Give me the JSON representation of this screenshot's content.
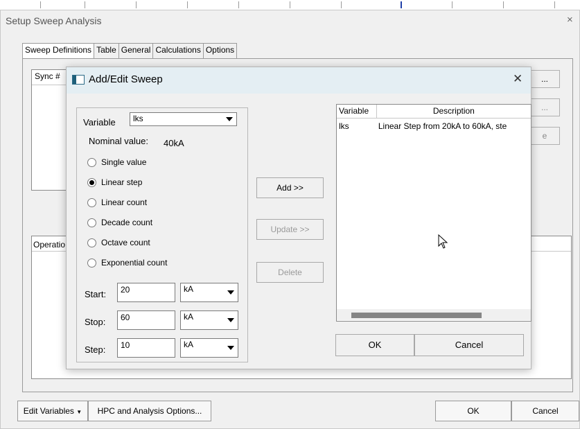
{
  "outer": {
    "title": "Setup Sweep Analysis",
    "close_glyph": "×",
    "tabs": [
      {
        "label": "Sweep Definitions",
        "active": true
      },
      {
        "label": "Table",
        "active": false
      },
      {
        "label": "General",
        "active": false
      },
      {
        "label": "Calculations",
        "active": false
      },
      {
        "label": "Options",
        "active": false
      }
    ],
    "sync_header": "Sync #",
    "operation_header": "Operatio",
    "side_button_1": "...",
    "side_button_2": "...",
    "side_button_3": "e",
    "edit_variables_label": "Edit Variables",
    "hpc_label": "HPC and Analysis Options...",
    "ok_label": "OK",
    "cancel_label": "Cancel"
  },
  "dialog": {
    "title": "Add/Edit Sweep",
    "close_glyph": "✕",
    "variable_label": "Variable",
    "variable_value": "lks",
    "nominal_label": "Nominal value:",
    "nominal_value": "40kA",
    "sweep_types": [
      {
        "label": "Single value",
        "checked": false
      },
      {
        "label": "Linear step",
        "checked": true
      },
      {
        "label": "Linear count",
        "checked": false
      },
      {
        "label": "Decade count",
        "checked": false
      },
      {
        "label": "Octave count",
        "checked": false
      },
      {
        "label": "Exponential count",
        "checked": false
      }
    ],
    "start_label": "Start:",
    "start_value": "20",
    "start_unit": "kA",
    "stop_label": "Stop:",
    "stop_value": "60",
    "stop_unit": "kA",
    "step_label": "Step:",
    "step_value": "10",
    "step_unit": "kA",
    "add_label": "Add >>",
    "update_label": "Update >>",
    "delete_label": "Delete",
    "table": {
      "columns": [
        "Variable",
        "Description"
      ],
      "rows": [
        {
          "variable": "lks",
          "description": "Linear Step from 20kA to 60kA, ste"
        }
      ]
    },
    "ok_label": "OK",
    "cancel_label": "Cancel"
  },
  "colors": {
    "dialog_bg": "#f0f0f0",
    "titlebar_bg": "#e4eef3",
    "icon_accent": "#1e5f7a",
    "scroll_thumb": "#858585"
  }
}
